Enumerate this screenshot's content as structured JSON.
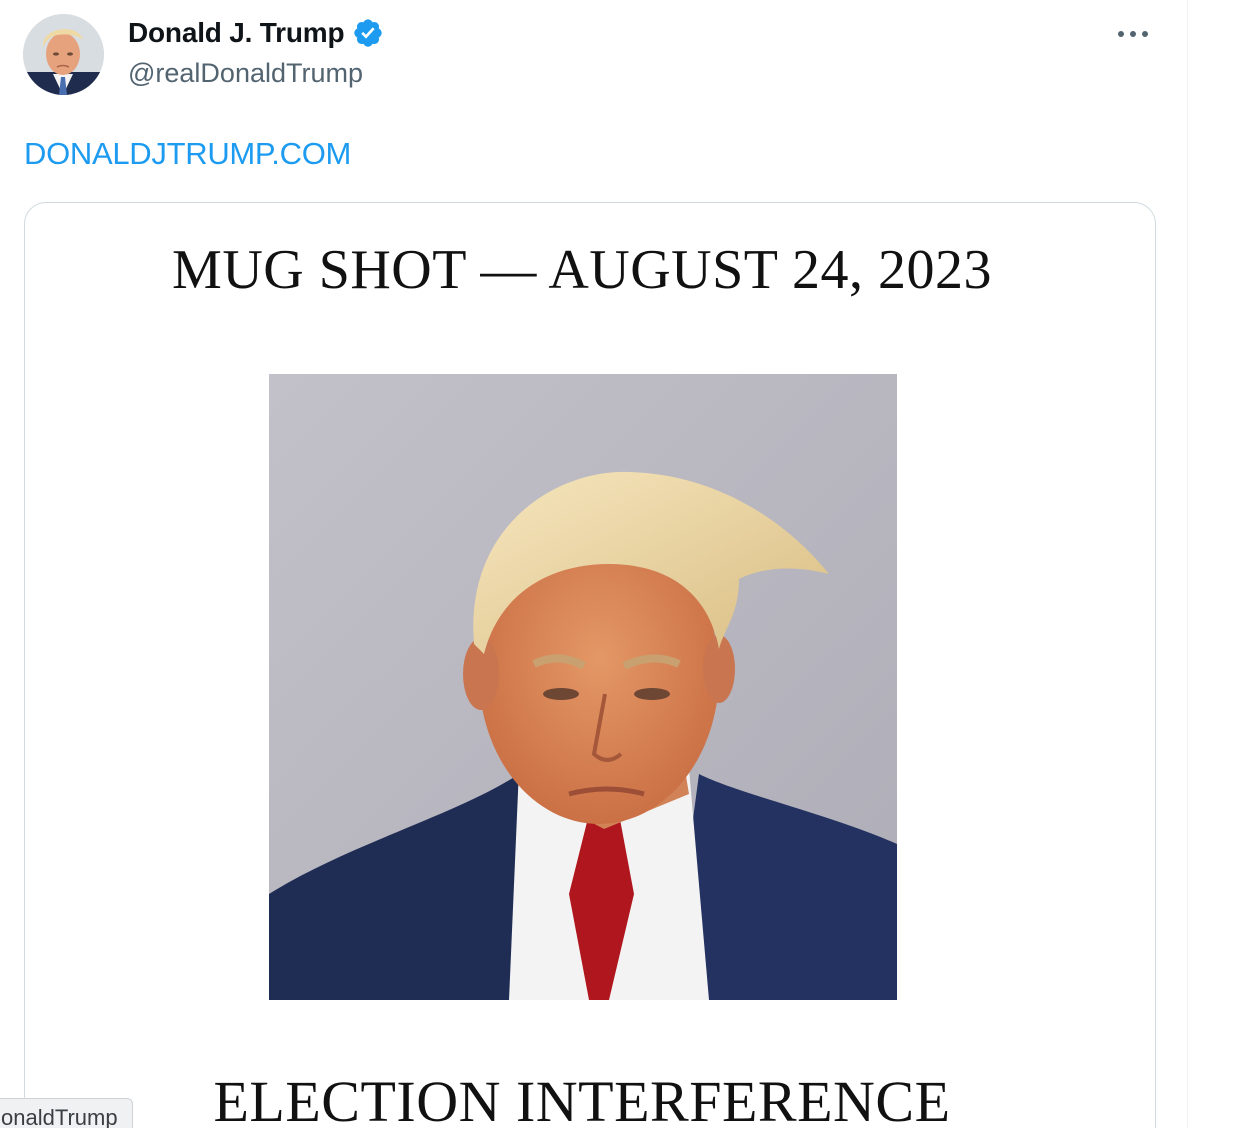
{
  "author": {
    "display_name": "Donald J. Trump",
    "handle": "@realDonaldTrump",
    "verified_badge_color": "#1d9bf0"
  },
  "post": {
    "link_text": "DONALDJTRUMP.COM",
    "link_color": "#1d9bf0"
  },
  "media": {
    "poster_title": "MUG SHOT — AUGUST 24, 2023",
    "poster_footer": "ELECTION INTERFERENCE"
  },
  "hover_status": {
    "text": "onaldTrump"
  },
  "icons": {
    "more": "more-horizontal-icon",
    "verified": "verified-badge-icon"
  }
}
